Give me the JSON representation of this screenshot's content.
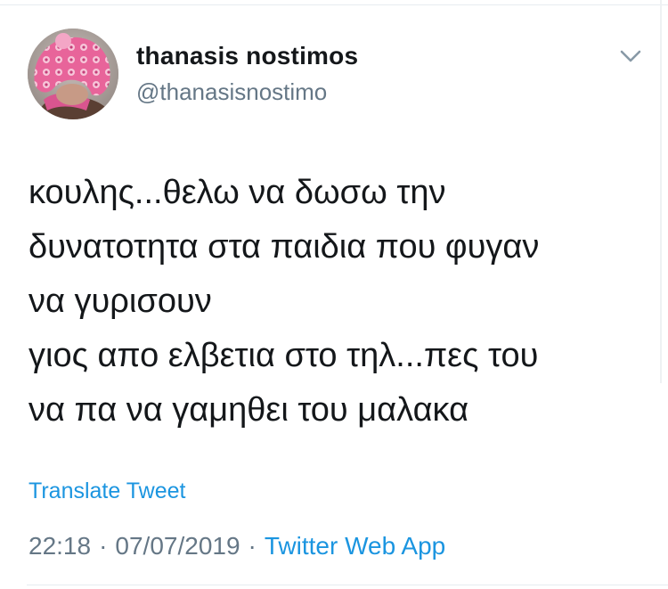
{
  "author": {
    "display_name": "thanasis nostimos",
    "handle": "@thanasisnostimo",
    "avatar_icon": "profile-photo-child-pink-hat"
  },
  "menu": {
    "icon": "chevron-down-icon"
  },
  "tweet": {
    "lines": [
      "κουλης...θελω να δωσω την",
      "δυνατοτητα στα παιδια που φυγαν",
      "να γυρισουν",
      "γιος απο ελβετια στο τηλ...πες του",
      "να πα να γαμηθει του μαλακα"
    ],
    "translate_label": "Translate Tweet"
  },
  "meta": {
    "time": "22:18",
    "separator": "·",
    "date": "07/07/2019",
    "source": "Twitter Web App"
  },
  "colors": {
    "text": "#14171a",
    "secondary": "#657786",
    "link": "#1b95e0",
    "divider": "#e6ecf0"
  }
}
